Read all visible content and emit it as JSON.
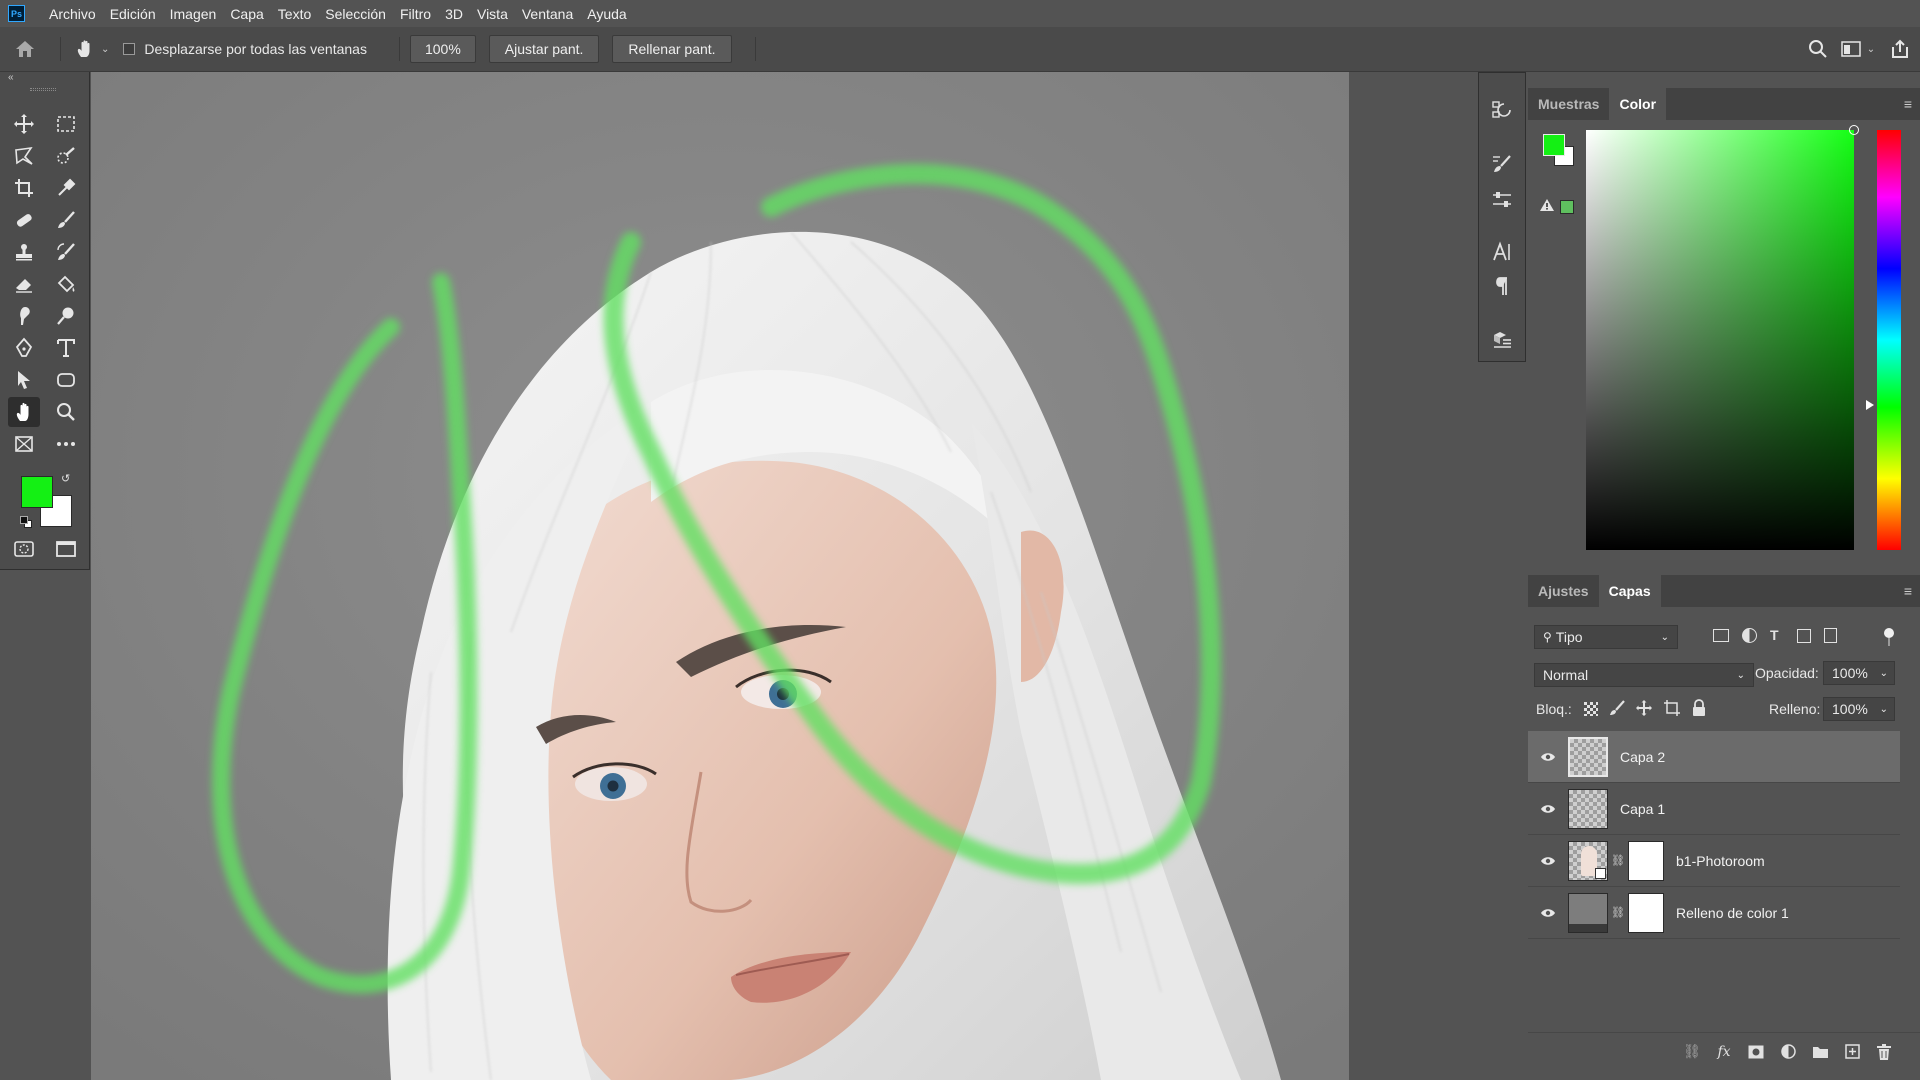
{
  "app": {
    "logo_text": "Ps",
    "menus": [
      "Archivo",
      "Edición",
      "Imagen",
      "Capa",
      "Texto",
      "Selección",
      "Filtro",
      "3D",
      "Vista",
      "Ventana",
      "Ayuda"
    ]
  },
  "options": {
    "scroll_all_label": "Desplazarse por todas las ventanas",
    "zoom_value": "100%",
    "fit_label": "Ajustar pant.",
    "fill_label": "Rellenar pant."
  },
  "colors": {
    "foreground": "#14f014",
    "background": "#ffffff",
    "brush_stroke": "#62e062",
    "accent": "#31a8ff"
  },
  "color_panel": {
    "tabs": [
      "Muestras",
      "Color"
    ],
    "active_tab": "Color"
  },
  "layers_panel": {
    "tabs": [
      "Ajustes",
      "Capas"
    ],
    "active_tab": "Capas",
    "filter_label": "Tipo",
    "blend_mode": "Normal",
    "opacity_label": "Opacidad:",
    "opacity_value": "100%",
    "lock_label": "Bloq.:",
    "fill_label": "Relleno:",
    "fill_value": "100%",
    "layers": [
      {
        "name": "Capa 2",
        "selected": true,
        "type": "pixel"
      },
      {
        "name": "Capa 1",
        "selected": false,
        "type": "pixel"
      },
      {
        "name": "b1-Photoroom",
        "selected": false,
        "type": "smart-masked"
      },
      {
        "name": "Relleno de color 1",
        "selected": false,
        "type": "fill-masked"
      }
    ]
  },
  "tools": [
    "move",
    "marquee",
    "lasso",
    "quick-select",
    "crop",
    "eyedropper",
    "healing",
    "brush",
    "stamp",
    "history-brush",
    "eraser",
    "paint-bucket",
    "smudge",
    "dodge",
    "pen",
    "type",
    "path-select",
    "rectangle",
    "hand",
    "zoom",
    "frame",
    "more"
  ],
  "active_tool": "hand"
}
